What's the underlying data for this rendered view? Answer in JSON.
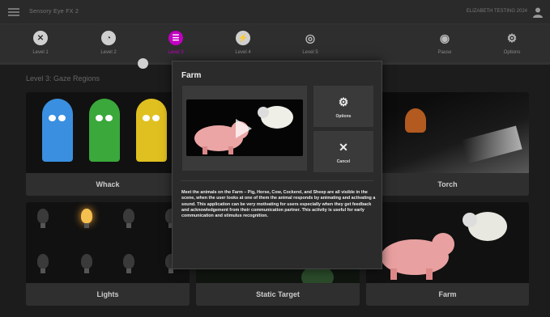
{
  "app": {
    "title": "Sensory Eye FX 2",
    "license": "ELIZABETH TESTING 2024"
  },
  "levels": [
    {
      "label": "Level 1",
      "icon": "✖"
    },
    {
      "label": "Level 2",
      "icon": "◔"
    },
    {
      "label": "Level 3",
      "icon": "☰",
      "active": true
    },
    {
      "label": "Level 4",
      "icon": "⚡"
    },
    {
      "label": "Level 5",
      "icon": "◎"
    },
    {
      "label": "Pause",
      "icon": "👁"
    },
    {
      "label": "Options",
      "icon": "⚙"
    }
  ],
  "section": {
    "title": "Level 3: Gaze Regions"
  },
  "tiles": [
    {
      "caption": "Whack"
    },
    {
      "caption": "Torch"
    },
    {
      "caption": "Lights"
    },
    {
      "caption": "Static Target"
    },
    {
      "caption": "Farm"
    }
  ],
  "modal": {
    "title": "Farm",
    "options_label": "Options",
    "cancel_label": "Cancel",
    "description": "Meet the animals on the Farm – Pig, Horse, Cow, Cockerel, and Sheep are all visible in the scene, when the user looks at one of them the animal responds by animating and activating a sound. This application can be very motivating for users especially when they get feedback and acknowledgement from their communication partner. This activity is useful for early communication and stimulus recognition."
  },
  "colors": {
    "accent": "#c000c0",
    "background": "#1c1c1c",
    "panel": "#2b2b2b"
  }
}
